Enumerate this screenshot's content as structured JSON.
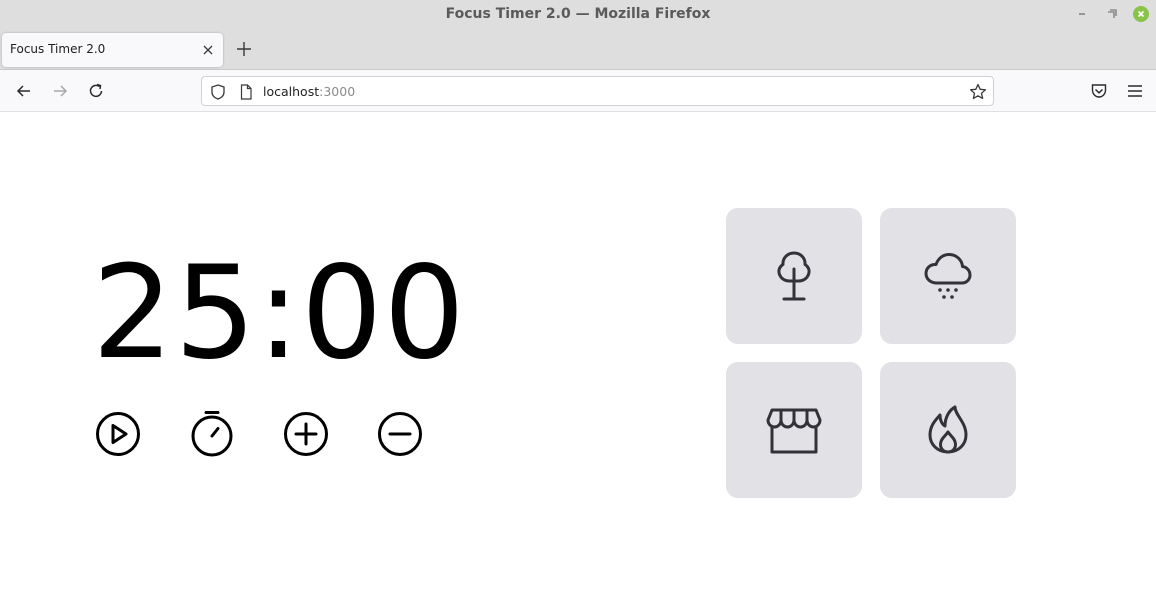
{
  "window": {
    "title": "Focus Timer 2.0 — Mozilla Firefox"
  },
  "browser": {
    "tab_title": "Focus Timer 2.0",
    "url_host": "localhost",
    "url_port": ":3000"
  },
  "timer": {
    "minutes": "25",
    "separator": ":",
    "seconds": "00"
  },
  "controls": [
    {
      "name": "play",
      "icon": "play-icon"
    },
    {
      "name": "stop",
      "icon": "stopwatch-icon"
    },
    {
      "name": "increase",
      "icon": "plus-circle-icon"
    },
    {
      "name": "decrease",
      "icon": "minus-circle-icon"
    }
  ],
  "sounds": [
    {
      "name": "forest",
      "icon": "tree-icon"
    },
    {
      "name": "rain",
      "icon": "cloud-rain-icon"
    },
    {
      "name": "coffee-shop",
      "icon": "storefront-icon"
    },
    {
      "name": "fireplace",
      "icon": "fire-icon"
    }
  ],
  "colors": {
    "card_background": "#e1e1e6",
    "icon_stroke": "#323238",
    "timer_text": "#000000",
    "close_button": "#8bc34a"
  }
}
